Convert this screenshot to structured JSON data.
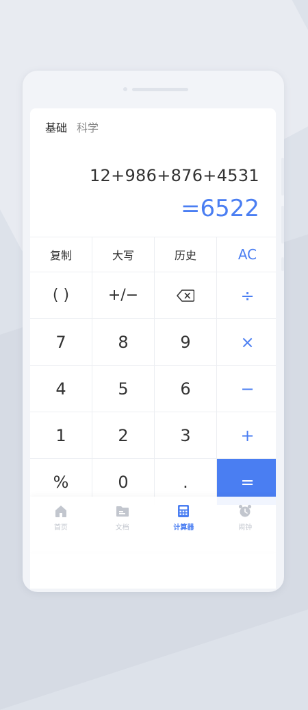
{
  "tabs": {
    "basic": "基础",
    "scientific": "科学"
  },
  "display": {
    "expression": "12+986+876+4531",
    "result": "=6522"
  },
  "keys": {
    "copy": "复制",
    "uppercase": "大写",
    "history": "历史",
    "clear": "AC",
    "parens": "( )",
    "sign": "+/−",
    "backspace_icon": "backspace-icon",
    "divide": "÷",
    "d7": "7",
    "d8": "8",
    "d9": "9",
    "multiply": "×",
    "d4": "4",
    "d5": "5",
    "d6": "6",
    "minus": "−",
    "d1": "1",
    "d2": "2",
    "d3": "3",
    "plus": "+",
    "percent": "%",
    "d0": "0",
    "dot": ".",
    "equals": "="
  },
  "nav": {
    "home": "首页",
    "docs": "文档",
    "calculator": "计算器",
    "alarm": "闹钟",
    "active": "calculator"
  },
  "colors": {
    "accent": "#4a7ef2",
    "inactive": "#c2c6ce",
    "background": "#dde2ea"
  }
}
